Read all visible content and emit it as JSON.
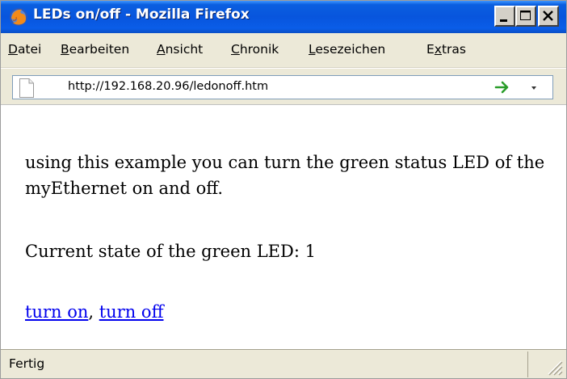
{
  "window": {
    "title": "LEDs on/off - Mozilla Firefox",
    "app_icon": "firefox-icon"
  },
  "title_buttons": [
    {
      "name": "minimize-button",
      "icon": "minimize-icon"
    },
    {
      "name": "maximize-button",
      "icon": "maximize-icon"
    },
    {
      "name": "close-button",
      "icon": "close-icon"
    }
  ],
  "menu": {
    "datei": {
      "pre": "",
      "key": "D",
      "post": "atei"
    },
    "bearbeiten": {
      "pre": "",
      "key": "B",
      "post": "earbeiten"
    },
    "ansicht": {
      "pre": "",
      "key": "A",
      "post": "nsicht"
    },
    "chronik": {
      "pre": "",
      "key": "C",
      "post": "hronik"
    },
    "lesezeichen": {
      "pre": "",
      "key": "L",
      "post": "esezeichen"
    },
    "extras": {
      "pre": "E",
      "key": "x",
      "post": "tras"
    }
  },
  "address": {
    "url": "http://192.168.20.96/ledonoff.htm",
    "page_icon": "page-icon",
    "go_icon": "go-arrow-icon",
    "dropdown_icon": "dropdown-arrow-icon"
  },
  "content": {
    "intro": "using this example you can turn the green status LED of the myEthernet on and off.",
    "state_label": "Current state of the green LED: 1",
    "link_on": "turn on",
    "separator": ", ",
    "link_off": "turn off"
  },
  "status": {
    "text": "Fertig",
    "grip_icon": "resize-grip-icon"
  },
  "colors": {
    "titlebar": "#0855dd",
    "chrome": "#ece9d8",
    "link": "#0000ee",
    "go_arrow": "#2a9d2a"
  }
}
